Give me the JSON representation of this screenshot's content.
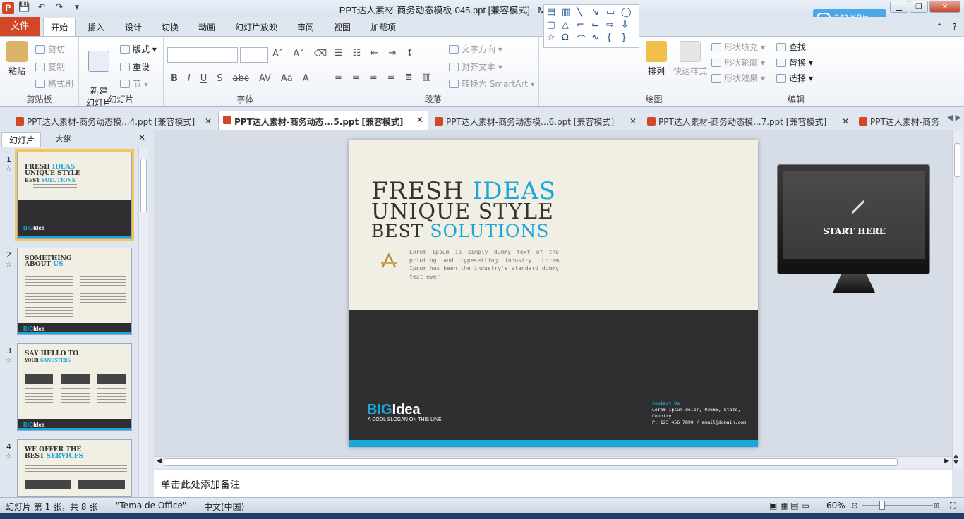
{
  "window": {
    "title": "PPT达人素材-商务动态模板-045.ppt [兼容模式]  -  Microsoft PowerPoint",
    "speed": "243 KB/s"
  },
  "ribbon_tabs": [
    "文件",
    "开始",
    "插入",
    "设计",
    "切换",
    "动画",
    "幻灯片放映",
    "审阅",
    "视图",
    "加载项"
  ],
  "ribbon": {
    "clipboard": {
      "label": "剪贴板",
      "paste": "粘贴",
      "cut": "剪切",
      "copy": "复制",
      "format_painter": "格式刷"
    },
    "slides": {
      "label": "幻灯片",
      "new_slide": "新建\n幻灯片",
      "layout": "版式",
      "reset": "重设",
      "section": "节"
    },
    "font": {
      "label": "字体"
    },
    "paragraph": {
      "label": "段落",
      "text_direction": "文字方向",
      "align_text": "对齐文本",
      "convert_smartart": "转换为 SmartArt"
    },
    "drawing": {
      "label": "绘图",
      "arrange": "排列",
      "quick_styles": "快速样式",
      "shape_fill": "形状填充",
      "shape_outline": "形状轮廓",
      "shape_effects": "形状效果"
    },
    "editing": {
      "label": "编辑",
      "find": "查找",
      "replace": "替换",
      "select": "选择"
    }
  },
  "doc_tabs": [
    "PPT达人素材-商务动态模...4.ppt [兼容模式]",
    "PPT达人素材-商务动态...5.ppt [兼容模式]",
    "PPT达人素材-商务动态模...6.ppt [兼容模式]",
    "PPT达人素材-商务动态模...7.ppt [兼容模式]",
    "PPT达人素材-商务"
  ],
  "side_panel": {
    "tab_slides": "幻灯片",
    "tab_outline": "大纲"
  },
  "thumbnails": [
    {
      "num": "1",
      "l1": "FRESH ",
      "l1b": "IDEAS",
      "l2": "UNIQUE STYLE",
      "l3": "BEST ",
      "l3b": "SOLUTIONS"
    },
    {
      "num": "2",
      "l1": "SOMETHING",
      "l2": "ABOUT ",
      "l2b": "US"
    },
    {
      "num": "3",
      "l1": "SAY HELLO TO",
      "l2": "YOUR ",
      "l2b": "GANGSTERS"
    },
    {
      "num": "4",
      "l1": "WE OFFER THE",
      "l2": "BEST ",
      "l2b": "SERVICES"
    }
  ],
  "slide": {
    "line1": "FRESH ",
    "line1_accent": "IDEAS",
    "line2": "UNIQUE STYLE",
    "line3": "BEST ",
    "line3_accent": "SOLUTIONS",
    "body": "Lorem Ipsum is simply dummy text of the printing and typesetting industry. Lorem Ipsum has been the industry's standard dummy text ever",
    "logo_a": "BIG",
    "logo_b": "Idea",
    "slogan": "A COOL SLOGAN ON THIS LINE",
    "contact_heading": "Contact Us",
    "contact_address": "Lorem ipsum dolor, 03665, State, Country",
    "contact_phone": "P.  123 456 7890 / email@domain.com"
  },
  "side_widget": {
    "start_label": "START HERE"
  },
  "notes_placeholder": "单击此处添加备注",
  "status": {
    "slide_info": "幻灯片 第 1 张，共 8 张",
    "theme": "\"Tema de Office\"",
    "language": "中文(中国)",
    "zoom": "60%"
  },
  "colors": {
    "accent": "#1aa6d9",
    "dark": "#2f2e31",
    "file_tab": "#d24726",
    "slide_bg": "#f1efe4"
  }
}
